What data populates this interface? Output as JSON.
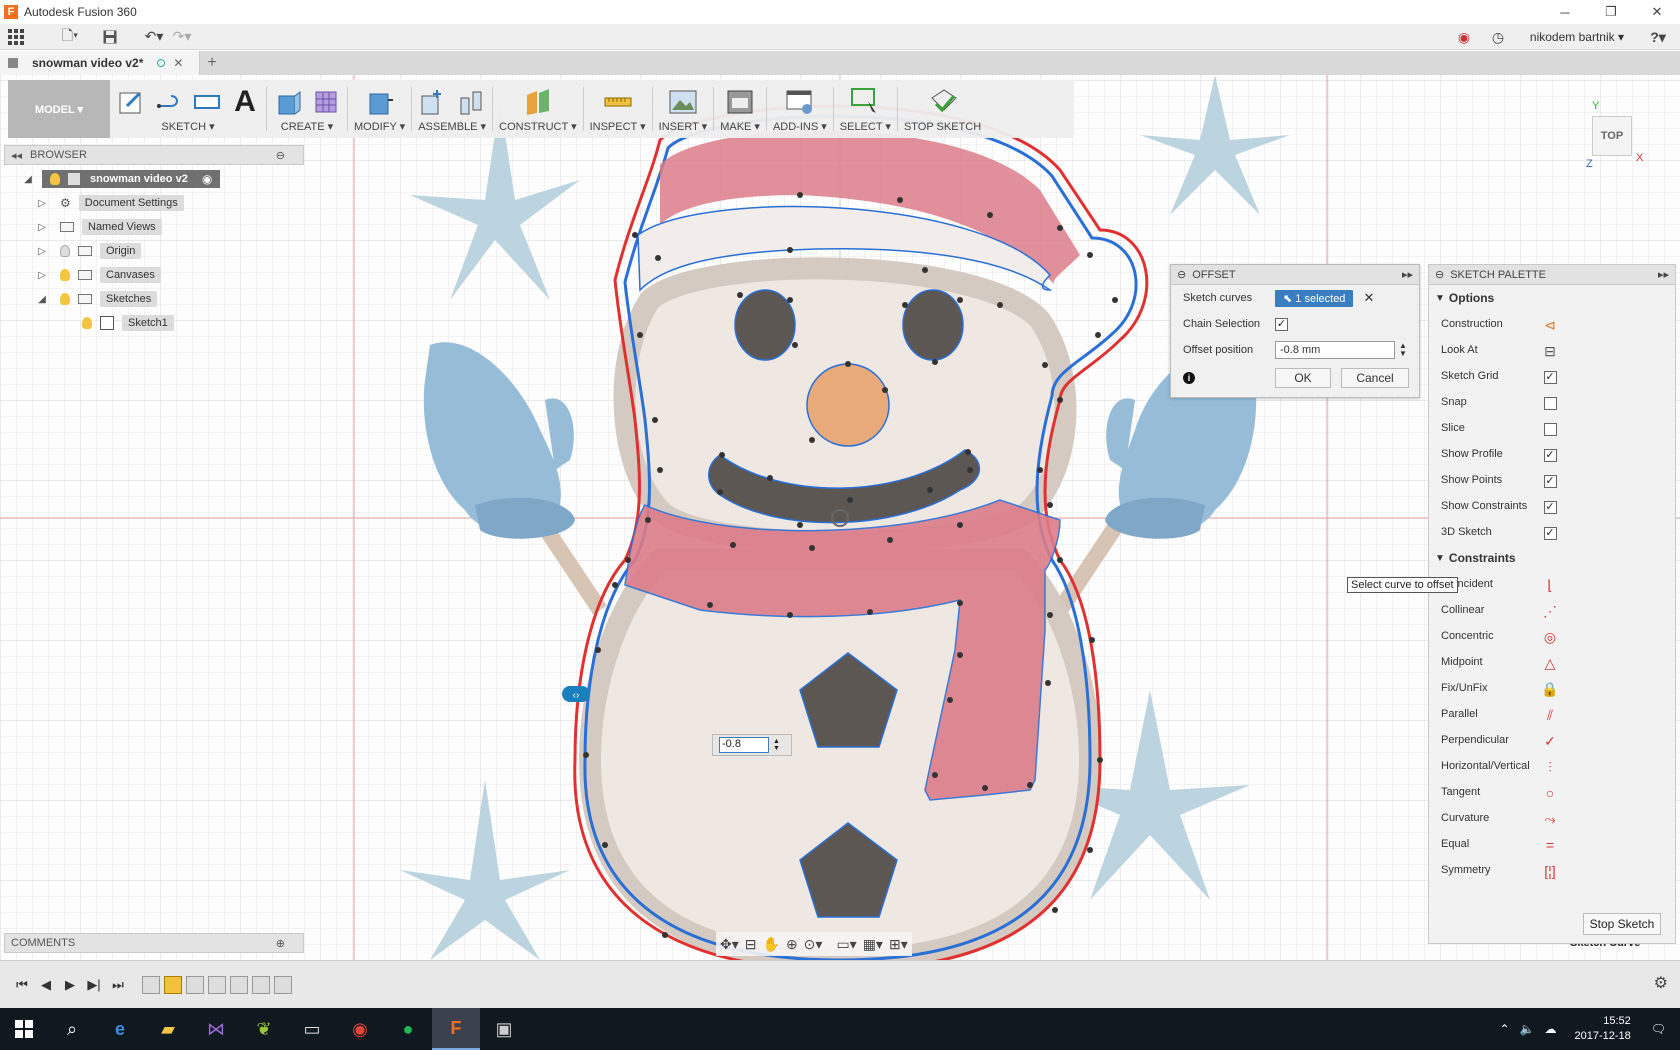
{
  "window": {
    "title": "Autodesk Fusion 360",
    "logo_letter": "F"
  },
  "qat": {
    "user": "nikodem bartnik ▾",
    "help": "?▾"
  },
  "tab": {
    "name": "snowman video v2*"
  },
  "toolbar": {
    "workspace": "MODEL ▾",
    "groups": {
      "sketch": "SKETCH ▾",
      "create": "CREATE ▾",
      "modify": "MODIFY ▾",
      "assemble": "ASSEMBLE ▾",
      "construct": "CONSTRUCT ▾",
      "inspect": "INSPECT ▾",
      "insert": "INSERT ▾",
      "make": "MAKE ▾",
      "addins": "ADD-INS ▾",
      "select": "SELECT ▾",
      "stop": "STOP SKETCH"
    }
  },
  "browser": {
    "title": "BROWSER",
    "root": "snowman video v2",
    "items": [
      "Document Settings",
      "Named Views",
      "Origin",
      "Canvases",
      "Sketches",
      "Sketch1"
    ]
  },
  "comments": {
    "title": "COMMENTS"
  },
  "offset": {
    "title": "OFFSET",
    "sketch_curves_label": "Sketch curves",
    "selected": "1 selected",
    "chain_label": "Chain Selection",
    "chain_checked": true,
    "position_label": "Offset position",
    "position_value": "-0.8 mm",
    "ok": "OK",
    "cancel": "Cancel"
  },
  "palette": {
    "title": "SKETCH PALETTE",
    "options_header": "Options",
    "options": [
      {
        "label": "Construction",
        "control": "icon"
      },
      {
        "label": "Look At",
        "control": "icon"
      },
      {
        "label": "Sketch Grid",
        "control": "checked"
      },
      {
        "label": "Snap",
        "control": "unchecked"
      },
      {
        "label": "Slice",
        "control": "unchecked"
      },
      {
        "label": "Show Profile",
        "control": "checked"
      },
      {
        "label": "Show Points",
        "control": "checked"
      },
      {
        "label": "Show Constraints",
        "control": "checked"
      },
      {
        "label": "3D Sketch",
        "control": "checked"
      }
    ],
    "constraints_header": "Constraints",
    "constraints": [
      "Coincident",
      "Collinear",
      "Concentric",
      "Midpoint",
      "Fix/UnFix",
      "Parallel",
      "Perpendicular",
      "Horizontal/Vertical",
      "Tangent",
      "Curvature",
      "Equal",
      "Symmetry"
    ],
    "stop_button": "Stop Sketch"
  },
  "tooltip": "Select curve to offset",
  "status_text": "Sketch Curve",
  "dim_input": "-0.8",
  "viewcube": {
    "face": "TOP",
    "x": "X",
    "y": "Y",
    "z": "Z"
  },
  "clock": {
    "time": "15:52",
    "date": "2017-12-18"
  },
  "colors": {
    "accent": "#3a7dc0",
    "offset_line": "#e03030",
    "curve": "#2a6fd6"
  }
}
